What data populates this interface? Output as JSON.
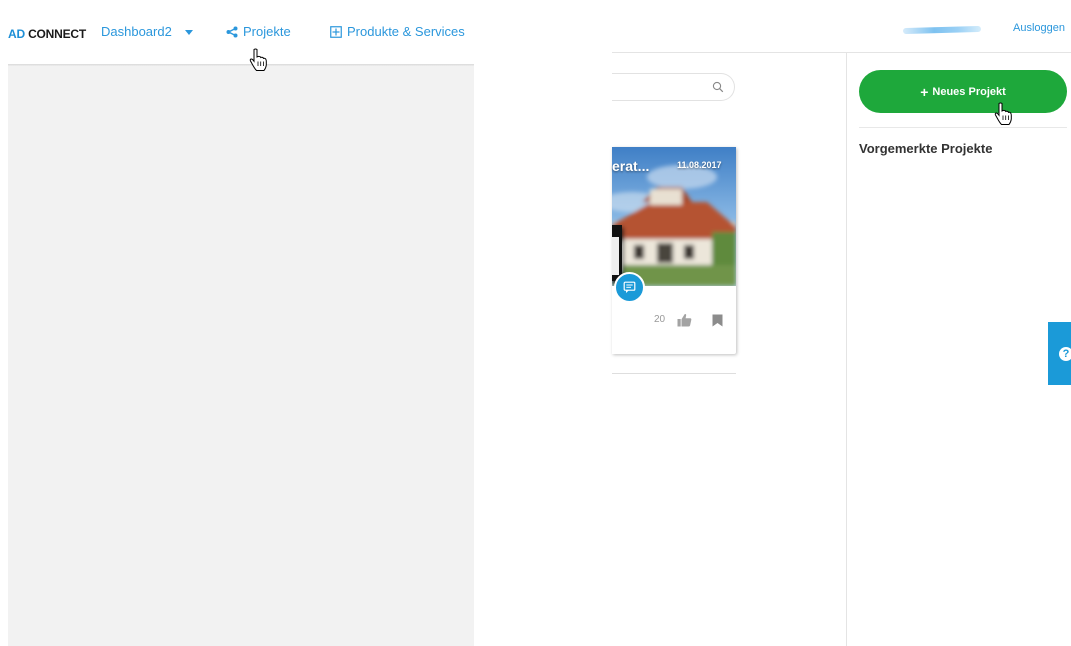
{
  "header": {
    "brand_prefix": "AD",
    "brand_suffix": " CONNECT",
    "nav": {
      "dashboard": "Dashboard2",
      "projekte": "Projekte",
      "produkte": "Produkte & Services"
    },
    "logout": "Ausloggen"
  },
  "search": {
    "placeholder": ""
  },
  "project_card": {
    "title": "erat...",
    "date": "11.08.2017",
    "likes": "20"
  },
  "sidebar": {
    "new_project_label": "Neues Projekt",
    "saved_projects_title": "Vorgemerkte Projekte"
  },
  "colors": {
    "accent_blue": "#2b97dc",
    "button_green": "#1ea83b",
    "help_blue": "#1b9ad8",
    "overlay_gray": "#f2f2f2"
  },
  "icons": [
    "share-icon",
    "grid-plus-icon",
    "search-icon",
    "comment-icon",
    "thumbs-up-icon",
    "bookmark-icon",
    "help-icon",
    "hand-cursor-icon"
  ]
}
